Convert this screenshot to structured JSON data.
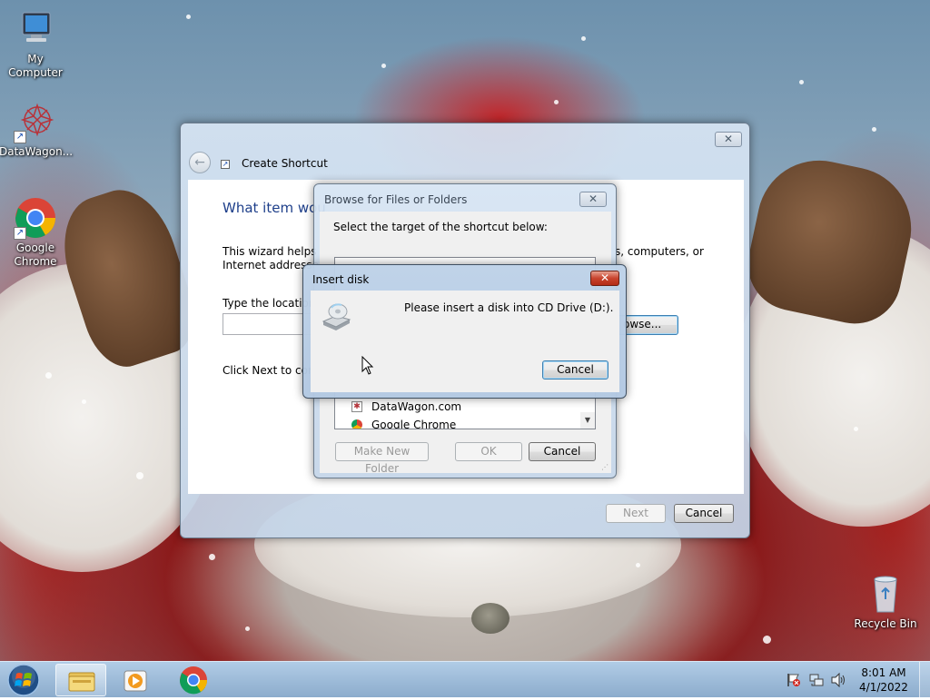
{
  "desktop": {
    "icons": [
      {
        "label": "My Computer"
      },
      {
        "label": "DataWagon..."
      },
      {
        "label": "Google Chrome"
      },
      {
        "label": "Recycle Bin"
      }
    ]
  },
  "create_shortcut": {
    "title": "Create Shortcut",
    "close_symbol": "✕",
    "heading": "What item wou",
    "description_line1": "This wizard helps yo",
    "description_right": "s, computers, or",
    "description_line2": "Internet addresse",
    "type_location_label": "Type the location",
    "location_value": "",
    "browse_label": "owse...",
    "click_next_text": "Click Next to con",
    "next_label": "Next",
    "cancel_label": "Cancel"
  },
  "browse_dialog": {
    "title": "Browse for Files or Folders",
    "close_symbol": "✕",
    "instruction": "Select the target of the shortcut below:",
    "tree_items": [
      {
        "label": "DataWagon.com"
      },
      {
        "label": "Google Chrome"
      }
    ],
    "make_new_folder_label": "Make New Folder",
    "ok_label": "OK",
    "cancel_label": "Cancel"
  },
  "insert_disk": {
    "title": "Insert disk",
    "close_symbol": "✕",
    "message": "Please insert a disk into CD Drive (D:).",
    "cancel_label": "Cancel"
  },
  "taskbar": {
    "time": "8:01 AM",
    "date": "4/1/2022"
  },
  "colors": {
    "heading_blue": "#1e3f8a",
    "taskbar": "#96b6d6"
  }
}
